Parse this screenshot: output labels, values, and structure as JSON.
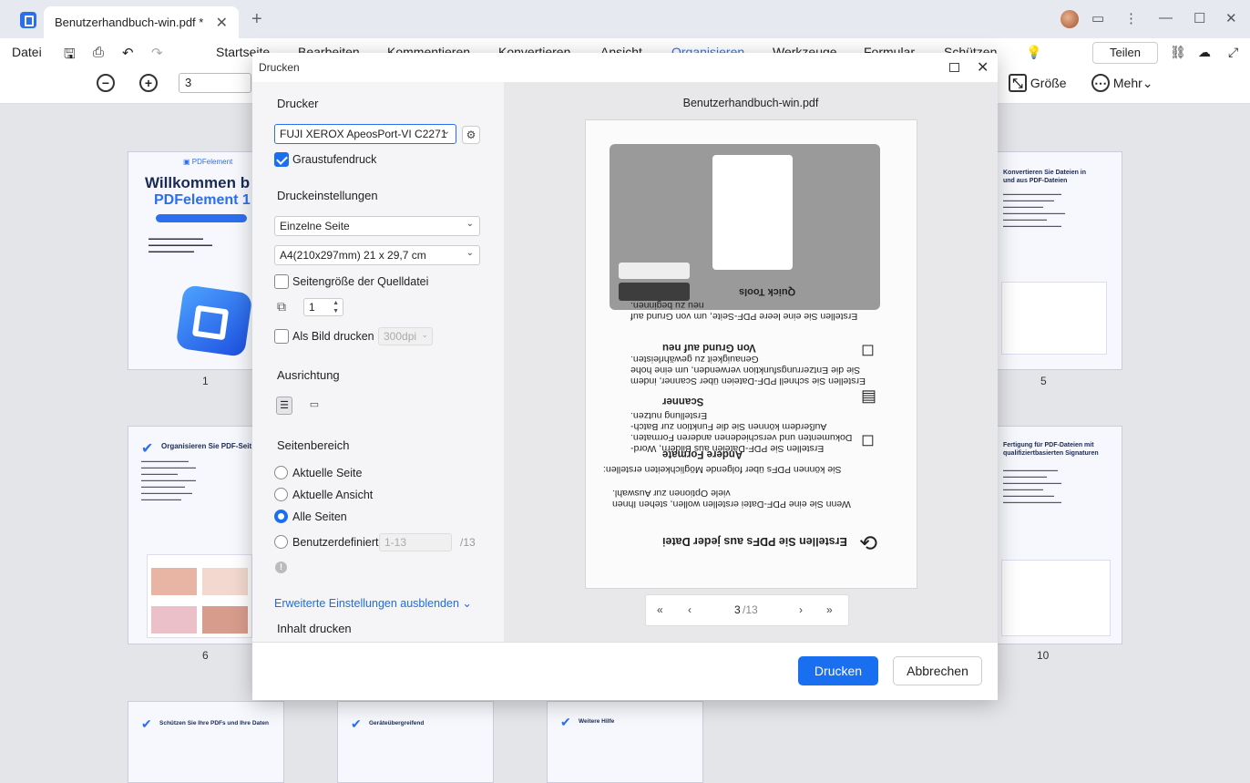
{
  "tab": {
    "title": "Benutzerhandbuch-win.pdf *"
  },
  "menu": {
    "file": "Datei",
    "items": [
      "Startseite",
      "Bearbeiten",
      "Kommentieren",
      "Konvertieren",
      "Ansicht",
      "Organisieren",
      "Werkzeuge",
      "Formular",
      "Schützen"
    ],
    "active": "Organisieren",
    "share": "Teilen"
  },
  "toolbar": {
    "page_value": "3",
    "size_label": "Größe",
    "more_label": "Mehr"
  },
  "thumbnails": {
    "labels": [
      "1",
      "5",
      "6",
      "10"
    ],
    "p1_title": "Willkommen b",
    "p1_sub": "PDFelement 1",
    "p6_title": "Organisieren Sie PDF-Seit",
    "p5_title": "Konvertieren Sie Dateien in und aus PDF-Dateien",
    "p10_title": "Fertigung für PDF-Dateien mit qualifiziertbasierten Signaturen",
    "b1": "Schützen Sie Ihre PDFs und Ihre Daten",
    "b2": "Geräteübergreifend",
    "b3": "Weitere Hilfe"
  },
  "dialog": {
    "title": "Drucken",
    "printer_heading": "Drucker",
    "printer": "FUJI XEROX ApeosPort-VI C2271",
    "grayscale": "Graustufendruck",
    "settings_heading": "Druckeinstellungen",
    "pages_mode": "Einzelne Seite",
    "paper": "A4(210x297mm) 21 x 29,7 cm",
    "source_size": "Seitengröße der Quelldatei",
    "copies": "1",
    "as_image": "Als Bild drucken",
    "dpi": "300dpi",
    "orientation_heading": "Ausrichtung",
    "range_heading": "Seitenbereich",
    "range_options": [
      "Aktuelle Seite",
      "Aktuelle Ansicht",
      "Alle Seiten",
      "Benutzerdefiniert"
    ],
    "custom_range": "1-13",
    "custom_total": "/13",
    "advanced_link": "Erweiterte Einstellungen ausblenden",
    "content_heading": "Inhalt drucken",
    "print_button": "Drucken",
    "cancel_button": "Abbrechen",
    "preview_filename": "Benutzerhandbuch-win.pdf",
    "pager_current": "3",
    "pager_total": "/13"
  },
  "preview": {
    "heading": "Erstellen Sie PDFs aus jeder Datei",
    "intro": "Wenn Sie eine PDF-Datei erstellen wollen, stehen Ihnen viele Optionen zur Auswahl.",
    "intro2": "Sie können PDFs über folgende Möglichkeiten erstellen:",
    "f1_title": "Andere Formate",
    "f1_text": "Erstellen Sie PDF-Dateien aus Bildern, Word-Dokumenten und verschiedenen anderen Formaten. Außerdem können Sie die Funktion zur Batch-Erstellung nutzen.",
    "f2_title": "Scanner",
    "f2_text": "Erstellen Sie schnell PDF-Dateien über Scanner, indem Sie die Entzerrungsfunktion verwenden, um eine hohe Genauigkeit zu gewährleisten.",
    "f3_title": "Von Grund auf neu",
    "f3_text": "Erstellen Sie eine leere PDF-Seite, um von Grund auf neu zu beginnen.",
    "quick_tools": "Quick Tools"
  }
}
